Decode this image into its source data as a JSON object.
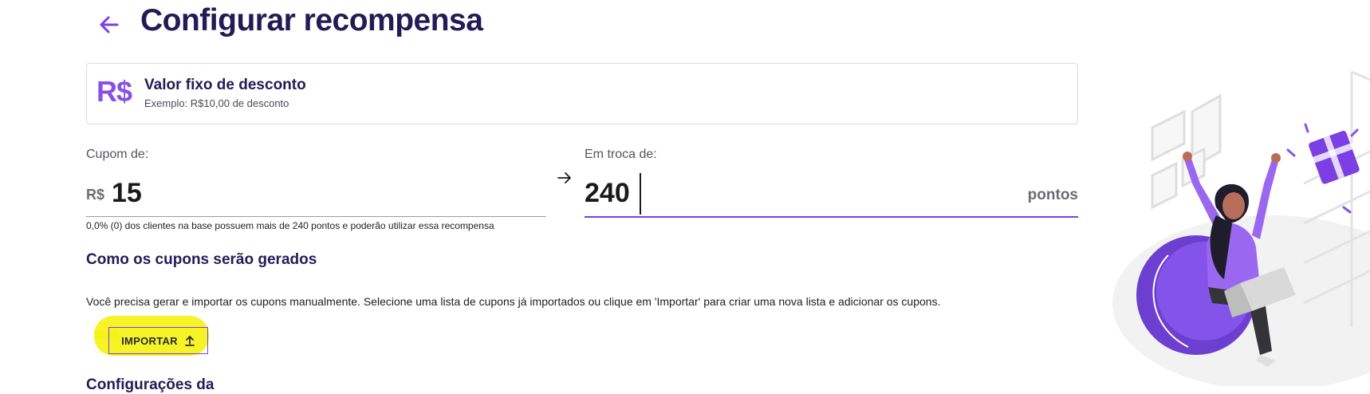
{
  "header": {
    "title": "Configurar recompensa",
    "back_icon": "arrow-left-icon"
  },
  "reward_type": {
    "icon_text": "R$",
    "title": "Valor fixo de desconto",
    "subtitle": "Exemplo: R$10,00 de desconto"
  },
  "coupon": {
    "label": "Cupom de:",
    "currency": "R$",
    "value": "15"
  },
  "exchange": {
    "label": "Em troca de:",
    "value": "240",
    "suffix": "pontos",
    "arrow_icon": "arrow-right-icon"
  },
  "helper_text": "0,0% (0) dos clientes na base possuem mais de 240 pontos e poderão utilizar essa recompensa",
  "generation": {
    "title": "Como os cupons serão gerados",
    "description": "Você precisa gerar e importar os cupons manualmente. Selecione uma lista de cupons já importados ou clique em 'Importar' para criar uma nova lista e adicionar os cupons.",
    "import_label": "IMPORTAR",
    "import_icon": "upload-icon"
  },
  "next_section": {
    "title": "Configurações da"
  },
  "colors": {
    "accent": "#7b3fe4",
    "title": "#241b56",
    "highlight": "#f6f21b"
  }
}
